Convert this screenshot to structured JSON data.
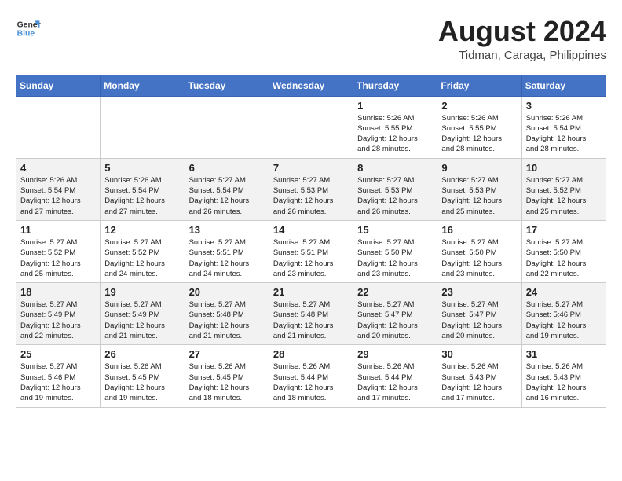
{
  "header": {
    "logo": {
      "line1": "General",
      "line2": "Blue"
    },
    "title": "August 2024",
    "location": "Tidman, Caraga, Philippines"
  },
  "days_of_week": [
    "Sunday",
    "Monday",
    "Tuesday",
    "Wednesday",
    "Thursday",
    "Friday",
    "Saturday"
  ],
  "weeks": [
    [
      {
        "day": "",
        "info": ""
      },
      {
        "day": "",
        "info": ""
      },
      {
        "day": "",
        "info": ""
      },
      {
        "day": "",
        "info": ""
      },
      {
        "day": "1",
        "info": "Sunrise: 5:26 AM\nSunset: 5:55 PM\nDaylight: 12 hours\nand 28 minutes."
      },
      {
        "day": "2",
        "info": "Sunrise: 5:26 AM\nSunset: 5:55 PM\nDaylight: 12 hours\nand 28 minutes."
      },
      {
        "day": "3",
        "info": "Sunrise: 5:26 AM\nSunset: 5:54 PM\nDaylight: 12 hours\nand 28 minutes."
      }
    ],
    [
      {
        "day": "4",
        "info": "Sunrise: 5:26 AM\nSunset: 5:54 PM\nDaylight: 12 hours\nand 27 minutes."
      },
      {
        "day": "5",
        "info": "Sunrise: 5:26 AM\nSunset: 5:54 PM\nDaylight: 12 hours\nand 27 minutes."
      },
      {
        "day": "6",
        "info": "Sunrise: 5:27 AM\nSunset: 5:54 PM\nDaylight: 12 hours\nand 26 minutes."
      },
      {
        "day": "7",
        "info": "Sunrise: 5:27 AM\nSunset: 5:53 PM\nDaylight: 12 hours\nand 26 minutes."
      },
      {
        "day": "8",
        "info": "Sunrise: 5:27 AM\nSunset: 5:53 PM\nDaylight: 12 hours\nand 26 minutes."
      },
      {
        "day": "9",
        "info": "Sunrise: 5:27 AM\nSunset: 5:53 PM\nDaylight: 12 hours\nand 25 minutes."
      },
      {
        "day": "10",
        "info": "Sunrise: 5:27 AM\nSunset: 5:52 PM\nDaylight: 12 hours\nand 25 minutes."
      }
    ],
    [
      {
        "day": "11",
        "info": "Sunrise: 5:27 AM\nSunset: 5:52 PM\nDaylight: 12 hours\nand 25 minutes."
      },
      {
        "day": "12",
        "info": "Sunrise: 5:27 AM\nSunset: 5:52 PM\nDaylight: 12 hours\nand 24 minutes."
      },
      {
        "day": "13",
        "info": "Sunrise: 5:27 AM\nSunset: 5:51 PM\nDaylight: 12 hours\nand 24 minutes."
      },
      {
        "day": "14",
        "info": "Sunrise: 5:27 AM\nSunset: 5:51 PM\nDaylight: 12 hours\nand 23 minutes."
      },
      {
        "day": "15",
        "info": "Sunrise: 5:27 AM\nSunset: 5:50 PM\nDaylight: 12 hours\nand 23 minutes."
      },
      {
        "day": "16",
        "info": "Sunrise: 5:27 AM\nSunset: 5:50 PM\nDaylight: 12 hours\nand 23 minutes."
      },
      {
        "day": "17",
        "info": "Sunrise: 5:27 AM\nSunset: 5:50 PM\nDaylight: 12 hours\nand 22 minutes."
      }
    ],
    [
      {
        "day": "18",
        "info": "Sunrise: 5:27 AM\nSunset: 5:49 PM\nDaylight: 12 hours\nand 22 minutes."
      },
      {
        "day": "19",
        "info": "Sunrise: 5:27 AM\nSunset: 5:49 PM\nDaylight: 12 hours\nand 21 minutes."
      },
      {
        "day": "20",
        "info": "Sunrise: 5:27 AM\nSunset: 5:48 PM\nDaylight: 12 hours\nand 21 minutes."
      },
      {
        "day": "21",
        "info": "Sunrise: 5:27 AM\nSunset: 5:48 PM\nDaylight: 12 hours\nand 21 minutes."
      },
      {
        "day": "22",
        "info": "Sunrise: 5:27 AM\nSunset: 5:47 PM\nDaylight: 12 hours\nand 20 minutes."
      },
      {
        "day": "23",
        "info": "Sunrise: 5:27 AM\nSunset: 5:47 PM\nDaylight: 12 hours\nand 20 minutes."
      },
      {
        "day": "24",
        "info": "Sunrise: 5:27 AM\nSunset: 5:46 PM\nDaylight: 12 hours\nand 19 minutes."
      }
    ],
    [
      {
        "day": "25",
        "info": "Sunrise: 5:27 AM\nSunset: 5:46 PM\nDaylight: 12 hours\nand 19 minutes."
      },
      {
        "day": "26",
        "info": "Sunrise: 5:26 AM\nSunset: 5:45 PM\nDaylight: 12 hours\nand 19 minutes."
      },
      {
        "day": "27",
        "info": "Sunrise: 5:26 AM\nSunset: 5:45 PM\nDaylight: 12 hours\nand 18 minutes."
      },
      {
        "day": "28",
        "info": "Sunrise: 5:26 AM\nSunset: 5:44 PM\nDaylight: 12 hours\nand 18 minutes."
      },
      {
        "day": "29",
        "info": "Sunrise: 5:26 AM\nSunset: 5:44 PM\nDaylight: 12 hours\nand 17 minutes."
      },
      {
        "day": "30",
        "info": "Sunrise: 5:26 AM\nSunset: 5:43 PM\nDaylight: 12 hours\nand 17 minutes."
      },
      {
        "day": "31",
        "info": "Sunrise: 5:26 AM\nSunset: 5:43 PM\nDaylight: 12 hours\nand 16 minutes."
      }
    ]
  ]
}
